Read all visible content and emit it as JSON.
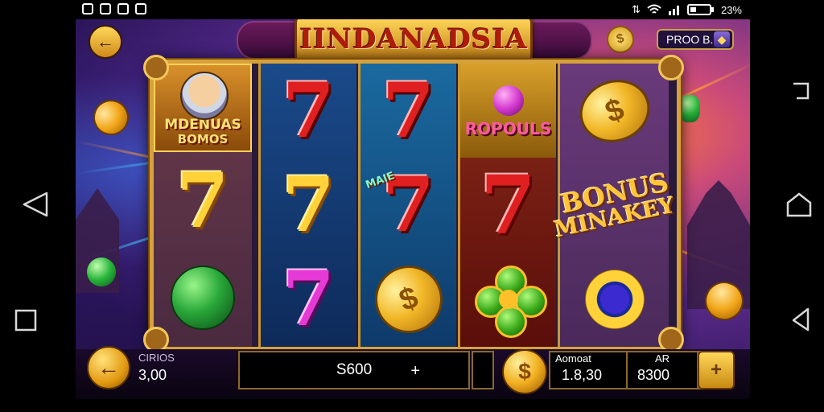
{
  "statusbar": {
    "battery": "23%"
  },
  "title": "IINDANADSIA",
  "promo": {
    "label": "PROO B."
  },
  "reels": {
    "reel1": {
      "top_line1": "MDENUAS",
      "top_line2": "BOMOS"
    },
    "reel4": {
      "top_text": "ROPOULS"
    },
    "reel5": {
      "bonus_line1": "BONUS",
      "bonus_line2": "MINAKEY"
    },
    "reel3": {
      "tag": "MAIE"
    }
  },
  "bottom": {
    "bet_label": "CIRIOS",
    "bet_value": "3,00",
    "balance": "S600",
    "plus": "+",
    "amount_label": "Aomoat",
    "amount_value": "1.8,30",
    "win_label": "AR",
    "win_value": "8300"
  },
  "colors": {
    "accent_gold": "#ffd23a",
    "reel_frame": "#d6a13a",
    "background": "#2a1555"
  },
  "icons": {
    "back": "arrow-left-icon",
    "bet": "arrow-left-icon",
    "spin": "plus-icon"
  }
}
